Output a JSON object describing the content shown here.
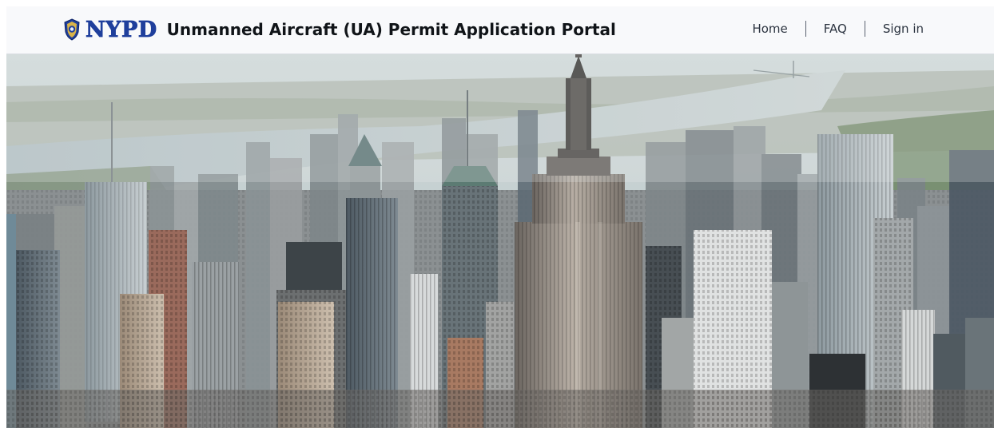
{
  "header": {
    "logo_text": "NYPD",
    "title": "Unmanned Aircraft (UA) Permit Application Portal",
    "logo_icon": "police-badge-icon"
  },
  "nav": {
    "items": [
      {
        "label": "Home"
      },
      {
        "label": "FAQ"
      },
      {
        "label": "Sign in"
      }
    ]
  },
  "hero": {
    "image": "aerial-manhattan-skyline-with-empire-state-building"
  },
  "colors": {
    "brand_blue": "#1f3f9c",
    "header_bg": "#f8f9fb",
    "title_text": "#101418",
    "nav_text": "#2c3440"
  }
}
